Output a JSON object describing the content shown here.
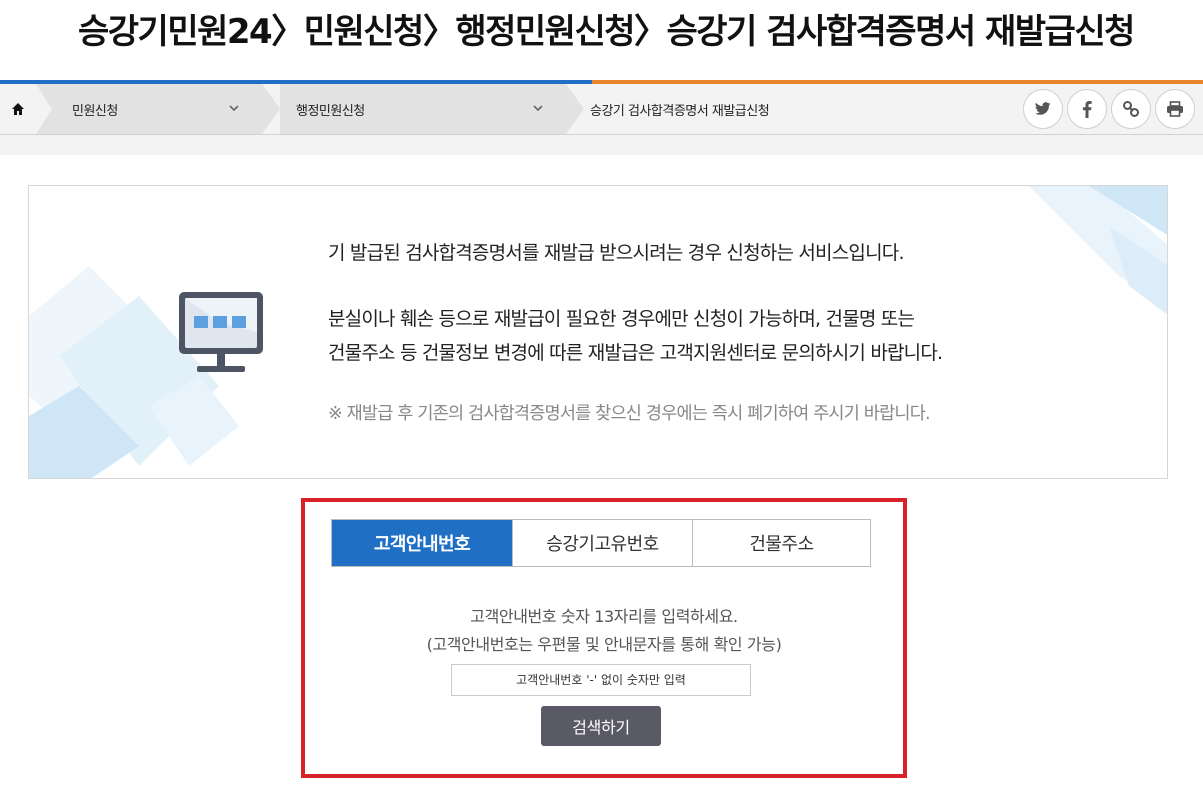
{
  "page_title": "승강기민원24〉민원신청〉행정민원신청〉승강기 검사합격증명서 재발급신청",
  "colors": {
    "primary_blue": "#1f6fc4",
    "accent_orange": "#e8852c",
    "highlight_red": "#d8222a",
    "button_gray": "#5a5a66"
  },
  "breadcrumb": {
    "home_icon": "home-icon",
    "items": [
      {
        "label": "민원신청",
        "dropdown": true
      },
      {
        "label": "행정민원신청",
        "dropdown": true
      },
      {
        "label": "승강기 검사합격증명서 재발급신청",
        "dropdown": false
      }
    ]
  },
  "share_icons": [
    "twitter-icon",
    "facebook-icon",
    "link-icon",
    "print-icon"
  ],
  "info": {
    "icon": "monitor-icon",
    "line1": "기 발급된 검사합격증명서를 재발급 받으시려는 경우 신청하는 서비스입니다.",
    "line2": "분실이나 훼손 등으로 재발급이 필요한 경우에만 신청이 가능하며, 건물명 또는",
    "line3": "건물주소 등 건물정보 변경에 따른 재발급은 고객지원센터로 문의하시기 바랍니다.",
    "note": "※ 재발급 후 기존의 검사합격증명서를 찾으신 경우에는 즉시 폐기하여 주시기 바랍니다."
  },
  "search": {
    "tabs": [
      {
        "label": "고객안내번호",
        "active": true
      },
      {
        "label": "승강기고유번호",
        "active": false
      },
      {
        "label": "건물주소",
        "active": false
      }
    ],
    "hint1": "고객안내번호 숫자 13자리를 입력하세요.",
    "hint2": "(고객안내번호는 우편물 및 안내문자를 통해 확인 가능)",
    "placeholder": "고객안내번호 '-' 없이 숫자만 입력",
    "value": "",
    "button_label": "검색하기"
  }
}
